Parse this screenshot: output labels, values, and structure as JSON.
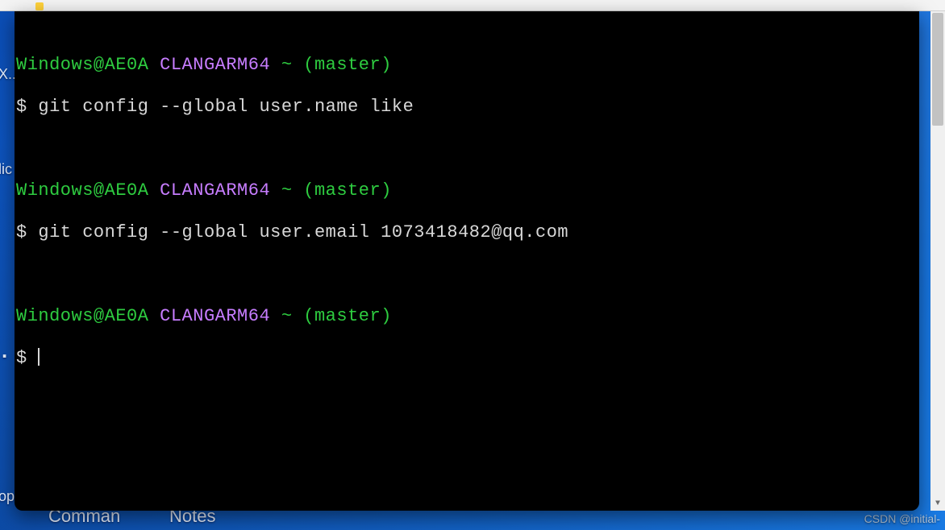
{
  "prompt": {
    "user": "Windows",
    "host": "AE0A",
    "at": "@",
    "env": "CLANGARM64",
    "tilde": "~",
    "branch": "(master)",
    "dollar": "$"
  },
  "commands": [
    "git config --global user.name like",
    "git config --global user.email 1073418482@qq.com"
  ],
  "desktop": {
    "labels": {
      "x": "X..",
      "lic": "lic",
      "dot": ".",
      "op": "op",
      "comman": "Comman",
      "notes": "Notes"
    },
    "watermark": "CSDN @initial-"
  },
  "scrollbar": {
    "arrow_up": "▲",
    "arrow_down": "▼"
  },
  "colors": {
    "user_host": "#2ecc40",
    "env": "#c77dff",
    "text": "#d8d8d8",
    "terminal_bg": "#000000",
    "desktop_blue": "#1166d6"
  }
}
